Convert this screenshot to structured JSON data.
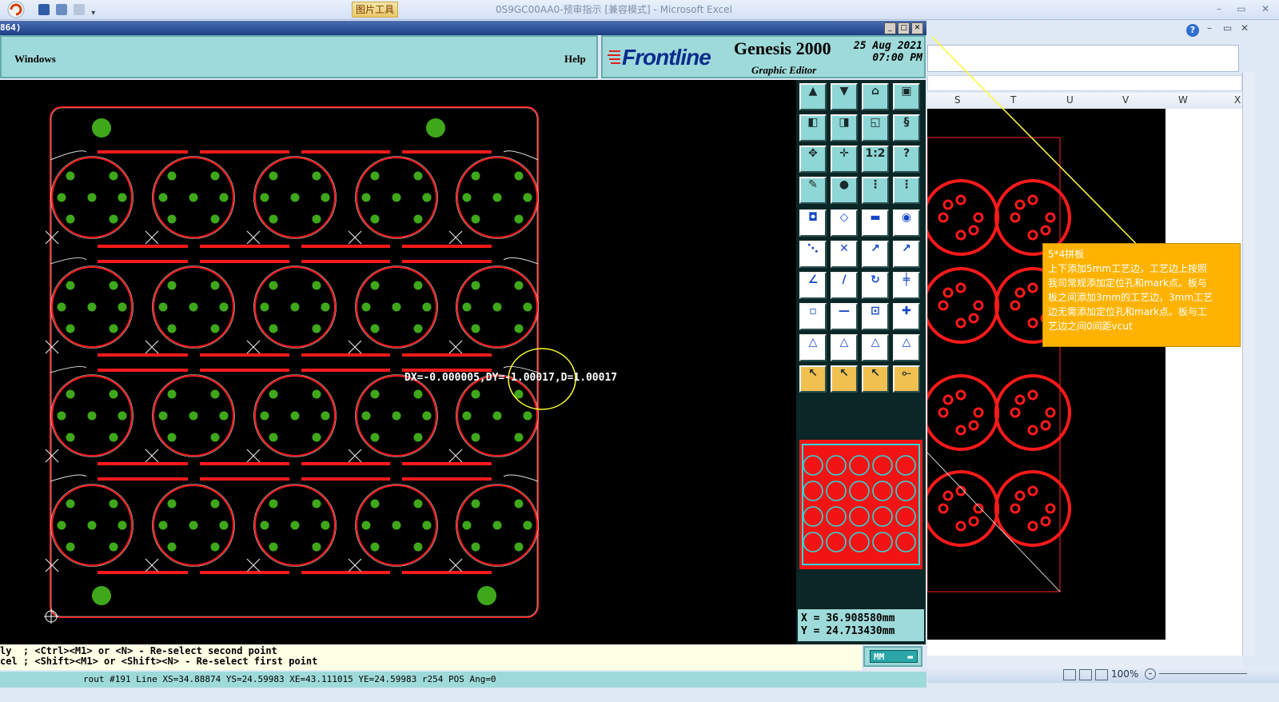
{
  "excel": {
    "title": "0S9GC00AA0-预审指示  [兼容模式] - Microsoft Excel",
    "picture_tools": "图片工具",
    "columns": [
      "S",
      "T",
      "U",
      "V",
      "W",
      "X"
    ],
    "zoom": "100%",
    "comment_lines": [
      "5*4拼板",
      "上下添加5mm工艺边，工艺边上按照",
      "我司常规添加定位孔和mark点。板与",
      "板之间添加3mm的工艺边，3mm工艺",
      "边无需添加定位孔和mark点。板与工",
      "艺边之间0间距vcut"
    ]
  },
  "genesis": {
    "title_fragment": "864)",
    "menu": {
      "windows": "Windows",
      "help": "Help"
    },
    "brand": {
      "name": "Frontline",
      "product": "Genesis 2000",
      "subtitle": "Graphic Editor",
      "date": "25 Aug 2021",
      "time": "07:00 PM"
    },
    "measurement": "DX=-0.000005,DY=-1.00017,D=1.00017",
    "coords": {
      "x": "X = 36.908580mm",
      "y": "Y = 24.713430mm"
    },
    "units": "MM",
    "status_lines": [
      "ly  ; <Ctrl><M1> or <N> - Re-select second point",
      "cel ; <Shift><M1> or <Shift><N> - Re-select first point"
    ],
    "command_line": "rout #191 Line XS=34.88874 YS=24.59983 XE=43.111015 YE=24.59983 r254 POS Ang=0",
    "toolbox_one_to_two": "1:2",
    "toolbox_help": "?"
  },
  "colors": {
    "board_outline": "#ff1a1a",
    "pad_green": "#3fa81a",
    "tool_cyan": "#8fd6d6",
    "comment": "#ffb300",
    "annotation_yellow": "#ffff33"
  }
}
